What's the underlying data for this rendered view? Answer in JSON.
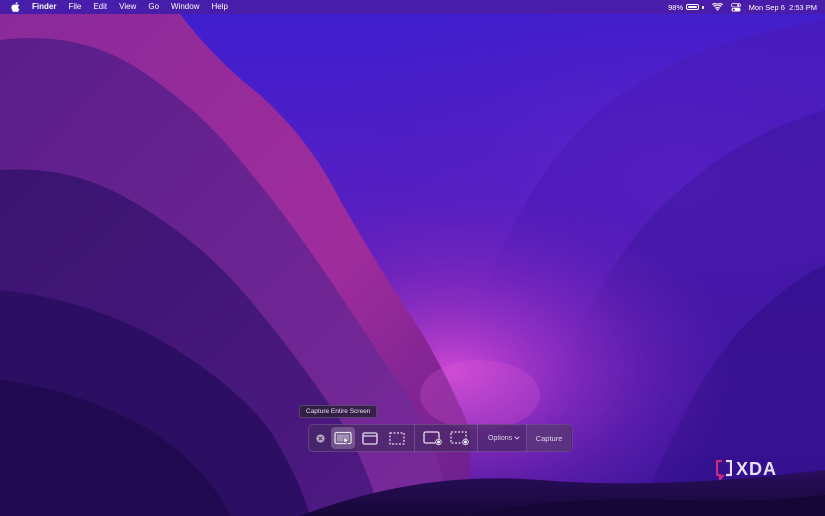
{
  "menubar": {
    "app_name": "Finder",
    "items": [
      "File",
      "Edit",
      "View",
      "Go",
      "Window",
      "Help"
    ],
    "battery_percent": "98%",
    "battery_level": 0.98,
    "clock": "Mon Sep 6  2:53 PM"
  },
  "tooltip": {
    "text": "Capture Entire Screen"
  },
  "toolbar": {
    "close_icon": "close-circle-icon",
    "tools": [
      {
        "id": "capture-entire-screen",
        "icon": "entire-screen-icon",
        "active": true
      },
      {
        "id": "capture-selected-window",
        "icon": "window-icon",
        "active": false
      },
      {
        "id": "capture-selected-portion",
        "icon": "dashed-selection-icon",
        "active": false
      },
      {
        "id": "record-entire-screen",
        "icon": "record-screen-icon",
        "active": false
      },
      {
        "id": "record-selected-portion",
        "icon": "record-selection-icon",
        "active": false
      }
    ],
    "options_label": "Options",
    "capture_label": "Capture"
  },
  "watermark": {
    "logo": "XDA"
  },
  "colors": {
    "wallpaper_top": "#3a1fcf",
    "wallpaper_glow": "#c23fd0",
    "wallpaper_dark": "#1b0a3d",
    "toolbar_bg": "#4a2a68",
    "menubar_text": "#ffffff"
  }
}
